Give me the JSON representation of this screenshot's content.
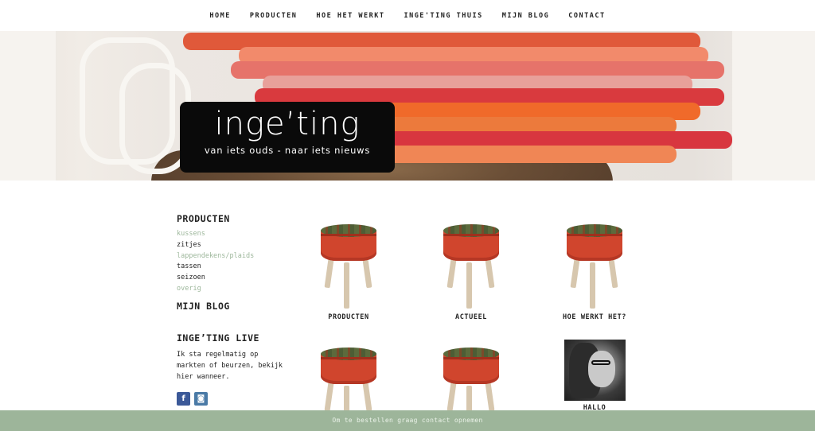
{
  "nav": {
    "items": [
      {
        "label": "HOME"
      },
      {
        "label": "PRODUCTEN"
      },
      {
        "label": "HOE HET WERKT"
      },
      {
        "label": "INGE'TING THUIS"
      },
      {
        "label": "MIJN BLOG"
      },
      {
        "label": "CONTACT"
      }
    ]
  },
  "hero": {
    "logo_title": "inge’ting",
    "logo_tagline": "van iets ouds - naar iets nieuws",
    "slide_count": 6,
    "active_slide": 1
  },
  "sidebar": {
    "products_heading": "PRODUCTEN",
    "products": [
      {
        "label": "kussens",
        "style": "muted"
      },
      {
        "label": "zitjes",
        "style": "normal"
      },
      {
        "label": "lappendekens/plaids",
        "style": "muted"
      },
      {
        "label": "tassen",
        "style": "normal"
      },
      {
        "label": "seizoen",
        "style": "normal"
      },
      {
        "label": "overig",
        "style": "muted"
      }
    ],
    "blog_heading": "MIJN BLOG",
    "live_heading": "INGE’TING LIVE",
    "live_text": "Ik sta regelmatig op markten of beurzen, bekijk hier wanneer.",
    "social": [
      {
        "icon": "facebook-icon",
        "glyph": "f",
        "color": "#3b5998"
      },
      {
        "icon": "instagram-icon",
        "glyph": "◙",
        "color": "#4a7aa6"
      }
    ]
  },
  "grid": {
    "items": [
      {
        "caption": "PRODUCTEN"
      },
      {
        "caption": "ACTUEEL"
      },
      {
        "caption": "HOE WERKT HET?"
      },
      {
        "caption": ""
      },
      {
        "caption": ""
      },
      {
        "caption": "HALLO"
      }
    ]
  },
  "cookie_bar": {
    "text": "Om te bestellen graag contact opnemen"
  },
  "colors": {
    "accent_green": "#9db59a",
    "stool_red": "#d0452d"
  }
}
